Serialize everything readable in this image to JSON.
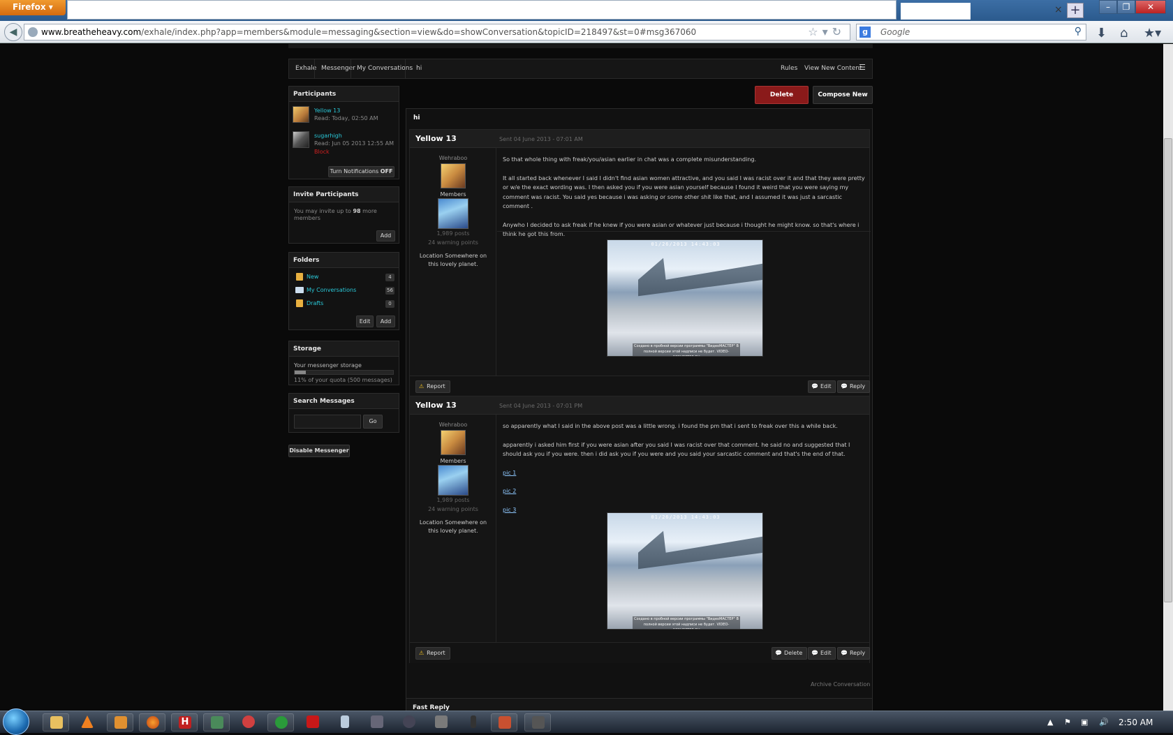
{
  "browser": {
    "menu_label": "Firefox",
    "url_host": "www.breatheheavy.com",
    "url_path": "/exhale/index.php?app=members&module=messaging&section=view&do=showConversation&topicID=218497&st=0#msg367060",
    "search_placeholder": "Google",
    "tab_close": "×",
    "tab_new": "+"
  },
  "breadcrumb": {
    "items": [
      "Exhale",
      "Messenger",
      "My Conversations",
      "hi"
    ],
    "right": [
      "Rules",
      "View New Content"
    ]
  },
  "participants": {
    "title": "Participants",
    "people": [
      {
        "name": "Yellow 13",
        "read": "Read: Today, 02:50 AM"
      },
      {
        "name": "sugarhigh",
        "read": "Read: Jun 05 2013 12:55 AM",
        "block": "Block"
      }
    ],
    "notify_label": "Turn Notifications",
    "notify_state": "OFF"
  },
  "invite": {
    "title": "Invite Participants",
    "text_pre": "You may invite up to",
    "count": "98",
    "text_post": "more members",
    "add": "Add"
  },
  "folders": {
    "title": "Folders",
    "items": [
      {
        "label": "New",
        "count": "4"
      },
      {
        "label": "My Conversations",
        "count": "56"
      },
      {
        "label": "Drafts",
        "count": "0"
      }
    ],
    "edit": "Edit",
    "add": "Add"
  },
  "storage": {
    "title": "Storage",
    "label": "Your messenger storage",
    "quota_text": "11% of your quota (500 messages)",
    "fill": 0.11
  },
  "search": {
    "title": "Search Messages",
    "go": "Go"
  },
  "disable_messenger": "Disable Messenger",
  "actions": {
    "delete": "Delete",
    "compose": "Compose New"
  },
  "conversation_title": "hi",
  "posts": [
    {
      "author": "Yellow 13",
      "date": "Sent 04 June 2013 - 07:01 AM",
      "user_title": "Wehraboo",
      "group": "Members",
      "posts": "1,989 posts",
      "warnings": "24 warning points",
      "location": "Location Somewhere on this lovely planet.",
      "paragraphs": [
        "So that whole thing with freak/you/asian earlier in chat was a complete misunderstanding.",
        "It all started back whenever I said I didn't find asian women attractive, and you said I was racist over it and that they were pretty or w/e the exact wording was. I then asked you if you were asian yourself because I found it weird that you were saying my comment was racist. You said yes because i was asking or some other shit like that, and I assumed it was just a sarcastic comment .",
        "Anywho I decided to ask freak if he knew if you were asian or whatever just because i thought he might know. so that's where i think he got this from."
      ],
      "image_timestamp": "01/26/2013 14:43:03",
      "image_watermark": "Создано в пробной версии программы \"ВидеоМАСТЕР\" В полной версии этой надписи не будет. VIDEO-CONVERTER.RU",
      "report": "Report",
      "edit": "Edit",
      "reply": "Reply"
    },
    {
      "author": "Yellow 13",
      "date": "Sent 04 June 2013 - 07:01 PM",
      "user_title": "Wehraboo",
      "group": "Members",
      "posts": "1,989 posts",
      "warnings": "24 warning points",
      "location": "Location Somewhere on this lovely planet.",
      "paragraphs": [
        "so apparently what I said in the above post was a little wrong. i found the pm that i sent to freak over this a while back.",
        "apparently i asked him first if you were asian after you said I was racist over that comment. he said no and suggested that I should ask you if you were. then i did ask you if you were and you said your sarcastic comment and that's the end of that."
      ],
      "links": [
        "pic 1",
        "pic 2",
        "pic 3"
      ],
      "image_timestamp": "01/26/2013 14:43:03",
      "image_watermark": "Создано в пробной версии программы \"ВидеоМАСТЕР\" В полной версии этой надписи не будет. VIDEO-CONVERTER.RU",
      "report": "Report",
      "delete": "Delete",
      "edit": "Edit",
      "reply": "Reply"
    }
  ],
  "archive": "Archive Conversation",
  "fast_reply": "Fast Reply",
  "taskbar": {
    "clock": "2:50 AM"
  },
  "colors": {
    "accent_link": "#2ac8d8",
    "delete_red": "#8a1a1a",
    "block_red": "#d02020"
  }
}
